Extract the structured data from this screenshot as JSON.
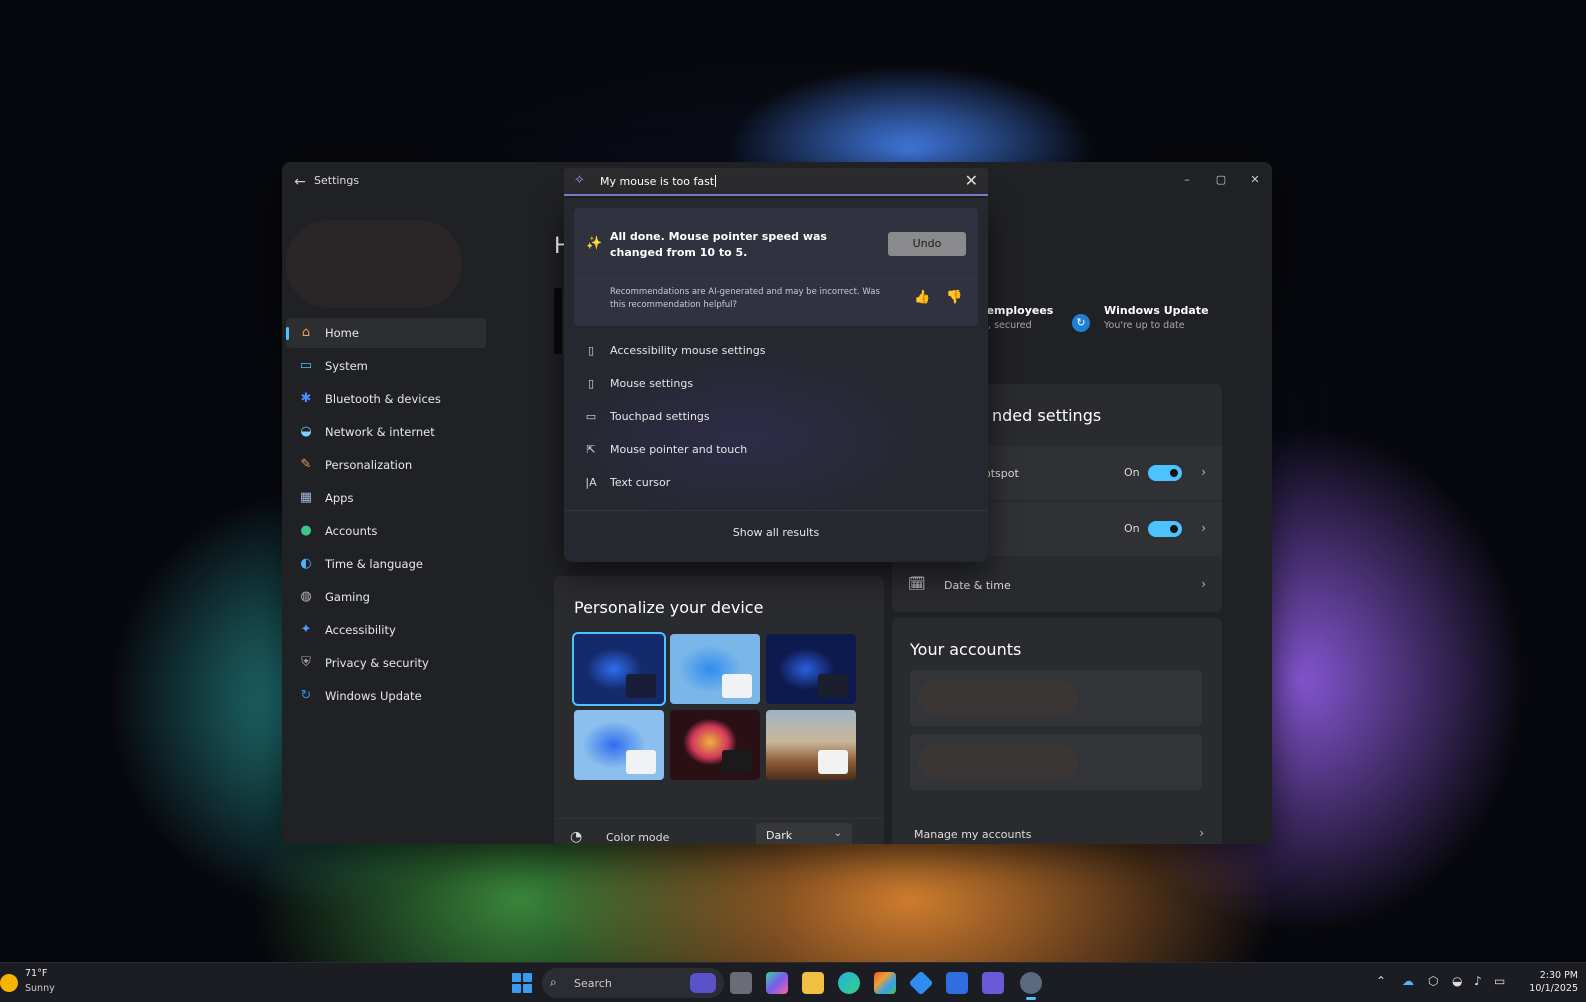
{
  "window": {
    "title": "Settings",
    "back": "←",
    "controls": {
      "minimize": "–",
      "maximize": "▢",
      "close": "✕"
    }
  },
  "search": {
    "value": "My mouse is too fast",
    "icon": "copilot-search-icon",
    "clear": "✕"
  },
  "ai_result": {
    "message": "All done. Mouse pointer speed was changed from 10 to 5.",
    "undo_label": "Undo",
    "note": "Recommendations are AI-generated and may be incorrect. Was this recommendation helpful?"
  },
  "results": [
    {
      "label": "Accessibility mouse settings",
      "icon": "mouse-icon"
    },
    {
      "label": "Mouse settings",
      "icon": "mouse-icon"
    },
    {
      "label": "Touchpad settings",
      "icon": "touchpad-icon"
    },
    {
      "label": "Mouse pointer and touch",
      "icon": "pointer-icon"
    },
    {
      "label": "Text cursor",
      "icon": "text-cursor-icon"
    }
  ],
  "show_all_label": "Show all results",
  "nav": [
    {
      "label": "Home",
      "icon": "home-icon",
      "glyph": "⌂",
      "color": "#f0a060"
    },
    {
      "label": "System",
      "icon": "system-icon",
      "glyph": "▭",
      "color": "#4cc2ff"
    },
    {
      "label": "Bluetooth & devices",
      "icon": "bluetooth-icon",
      "glyph": "✱",
      "color": "#4c8dff"
    },
    {
      "label": "Network & internet",
      "icon": "wifi-icon",
      "glyph": "◒",
      "color": "#7fd0ff"
    },
    {
      "label": "Personalization",
      "icon": "brush-icon",
      "glyph": "✎",
      "color": "#e0a060"
    },
    {
      "label": "Apps",
      "icon": "apps-icon",
      "glyph": "▦",
      "color": "#9db4d8"
    },
    {
      "label": "Accounts",
      "icon": "accounts-icon",
      "glyph": "●",
      "color": "#3fc48a"
    },
    {
      "label": "Time & language",
      "icon": "globe-icon",
      "glyph": "◐",
      "color": "#4cb4ff"
    },
    {
      "label": "Gaming",
      "icon": "gaming-icon",
      "glyph": "◍",
      "color": "#bbbbbb"
    },
    {
      "label": "Accessibility",
      "icon": "accessibility-icon",
      "glyph": "✦",
      "color": "#4c9fff"
    },
    {
      "label": "Privacy & security",
      "icon": "shield-icon",
      "glyph": "⛨",
      "color": "#aaaaaa"
    },
    {
      "label": "Windows Update",
      "icon": "update-icon",
      "glyph": "↻",
      "color": "#2f8de4"
    }
  ],
  "main": {
    "heading": "H",
    "chips": {
      "employees_title": "-employees",
      "employees_sub": "d, secured",
      "wu_title": "Windows Update",
      "wu_sub": "You're up to date"
    },
    "recommended": {
      "title": "nded settings",
      "rows": [
        {
          "label": "otspot",
          "state": "On"
        },
        {
          "label": "",
          "state": "On"
        }
      ],
      "date_time": "Date & time"
    },
    "personalize": {
      "title": "Personalize your device",
      "color_mode_label": "Color mode",
      "color_mode_value": "Dark"
    },
    "accounts": {
      "title": "Your accounts",
      "manage": "Manage my accounts"
    }
  },
  "taskbar": {
    "temp": "71°F",
    "condition": "Sunny",
    "search_label": "Search",
    "time": "2:30 PM",
    "date": "10/1/2025"
  },
  "colors": {
    "accent": "#4cc2ff",
    "copilot": "#8b7bd6"
  }
}
